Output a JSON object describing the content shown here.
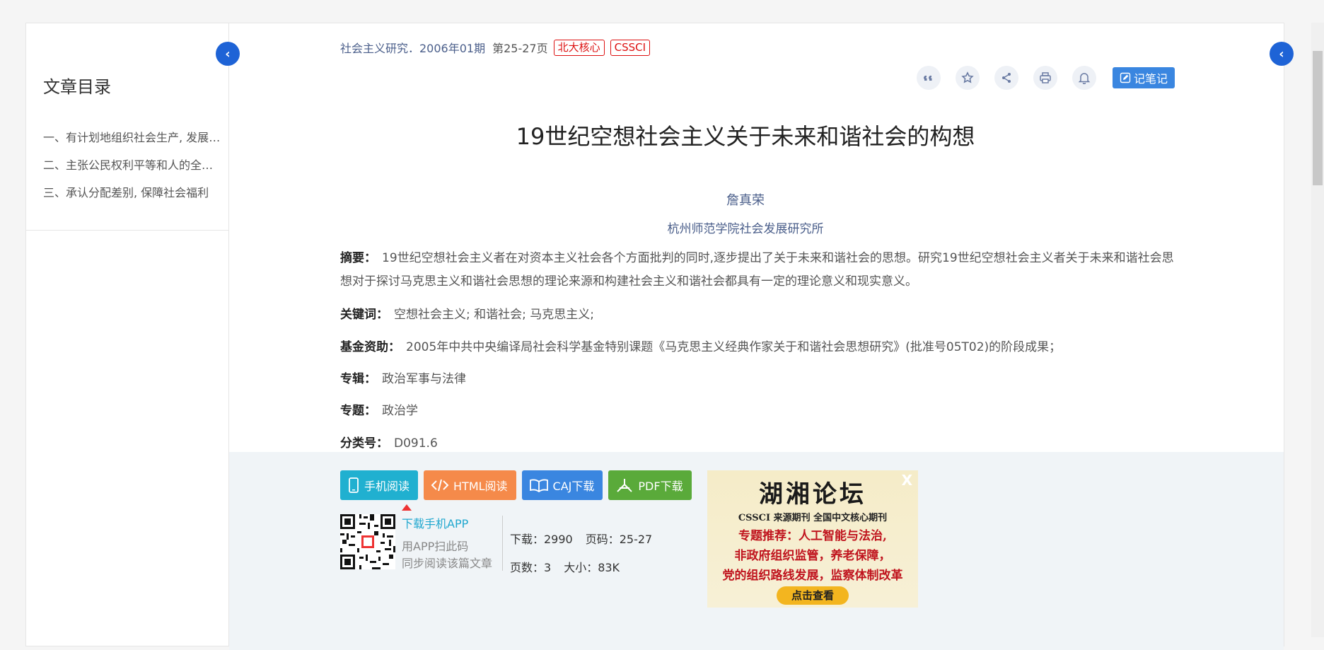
{
  "sidebar": {
    "title": "文章目录",
    "items": [
      "一、有计划地组织社会生产, 发展社会生产力",
      "二、主张公民权利平等和人的全面发展",
      "三、承认分配差别, 保障社会福利"
    ]
  },
  "header": {
    "journal": "社会主义研究．2006年01期",
    "pages": "第25-27页",
    "tags": [
      "北大核心",
      "CSSCI"
    ]
  },
  "tools": {
    "icons": [
      "quote-icon",
      "star-icon",
      "share-icon",
      "print-icon",
      "bell-icon"
    ],
    "note_label": "记笔记"
  },
  "article": {
    "title": "19世纪空想社会主义关于未来和谐社会的构想",
    "author": "詹真荣",
    "organization": "杭州师范学院社会发展研究所",
    "abstract_label": "摘要：",
    "abstract": "19世纪空想社会主义者在对资本主义社会各个方面批判的同时,逐步提出了关于未来和谐社会的思想。研究19世纪空想社会主义者关于未来和谐社会思想对于探讨马克思主义和谐社会思想的理论来源和构建社会主义和谐社会都具有一定的理论意义和现实意义。",
    "keywords_label": "关键词：",
    "keywords": "空想社会主义;  和谐社会;  马克思主义;",
    "fund_label": "基金资助：",
    "fund": "2005年中共中央编译局社会科学基金特别课题《马克思主义经典作家关于和谐社会思想研究》(批准号05T02)的阶段成果；",
    "album_label": "专辑：",
    "album": "政治军事与法律",
    "topic_label": "专题：",
    "topic": "政治学",
    "class_label": "分类号：",
    "class": "D091.6"
  },
  "download": {
    "buttons": [
      "手机阅读",
      "HTML阅读",
      "CAJ下载",
      "PDF下载"
    ],
    "app_link": "下载手机APP",
    "app_tip_1": "用APP扫此码",
    "app_tip_2": "同步阅读该篇文章",
    "downloads": "下载：2990",
    "page_range": "页码：25-27",
    "page_count": "页数：3",
    "size": "大小：83K"
  },
  "ad": {
    "title": "湖湘论坛",
    "subtitle": "CSSCI 来源期刊   全国中文核心期刊",
    "lines": [
      "专题推荐：人工智能与法治,",
      "非政府组织监管，养老保障，",
      "党的组织路线发展，监察体制改革"
    ],
    "button": "点击查看",
    "close": "X"
  },
  "colors": {
    "accent": "#1e63d6",
    "link": "#4a5e8a",
    "tag": "#dd1111"
  }
}
